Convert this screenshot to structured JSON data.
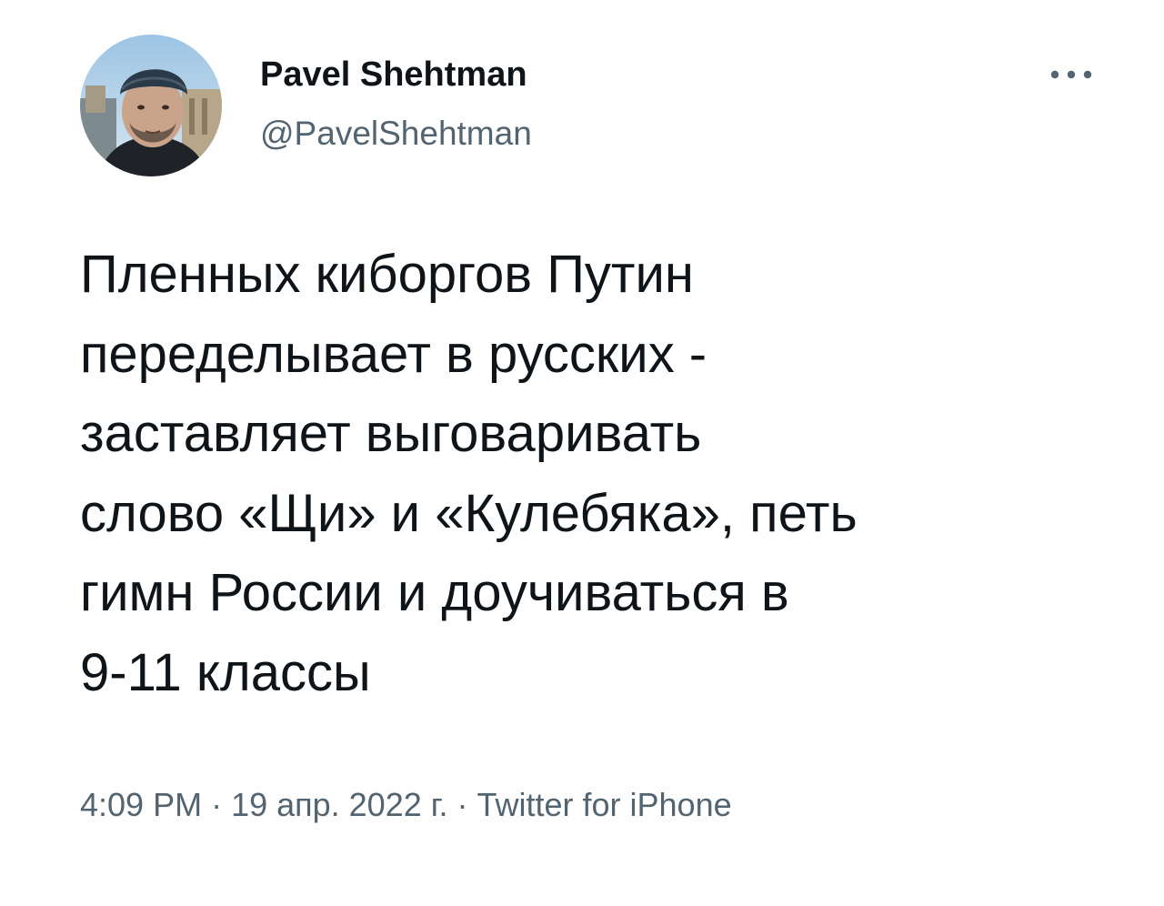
{
  "author": {
    "name": "Pavel Shehtman",
    "handle": "@PavelShehtman"
  },
  "tweet": {
    "text": "Пленных киборгов Путин\nпеределывает в русских -\nзаставляет выговаривать\nслово «Щи» и «Кулебяка», петь\nгимн России и доучиваться в\n9-11 классы"
  },
  "meta": {
    "time": "4:09 PM",
    "separator": " · ",
    "date": "19 апр. 2022 г.",
    "source": "Twitter for iPhone"
  },
  "icons": {
    "more": "more-horizontal-icon"
  },
  "colors": {
    "text_primary": "#0f1419",
    "text_secondary": "#536471",
    "background": "#ffffff"
  }
}
